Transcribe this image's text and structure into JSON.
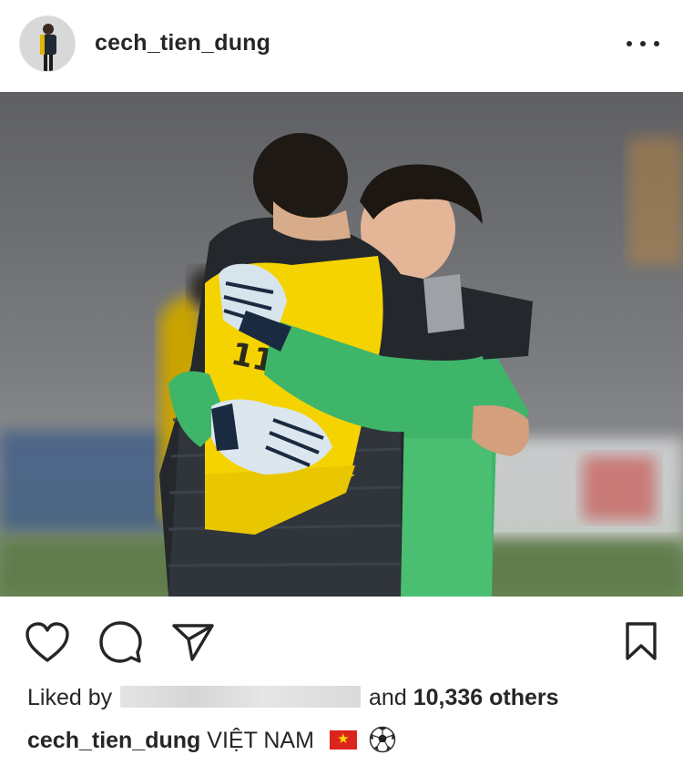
{
  "header": {
    "username": "cech_tien_dung",
    "avatar_icon": "profile-avatar",
    "more_icon": "more-options-icon"
  },
  "photo": {
    "subject": "players-embracing-photo"
  },
  "actions": {
    "like_icon": "heart-icon",
    "comment_icon": "comment-icon",
    "share_icon": "direct-share-icon",
    "save_icon": "bookmark-icon"
  },
  "likes": {
    "prefix": "Liked by",
    "middle": "and",
    "count": "10,336 others"
  },
  "caption": {
    "username": "cech_tien_dung",
    "text": "VIỆT NAM"
  },
  "colors": {
    "text": "#262626",
    "flag_red": "#da251d",
    "flag_star": "#ffdd00",
    "jersey_yellow": "#f5d300",
    "keeper_green": "#3fb56a"
  }
}
